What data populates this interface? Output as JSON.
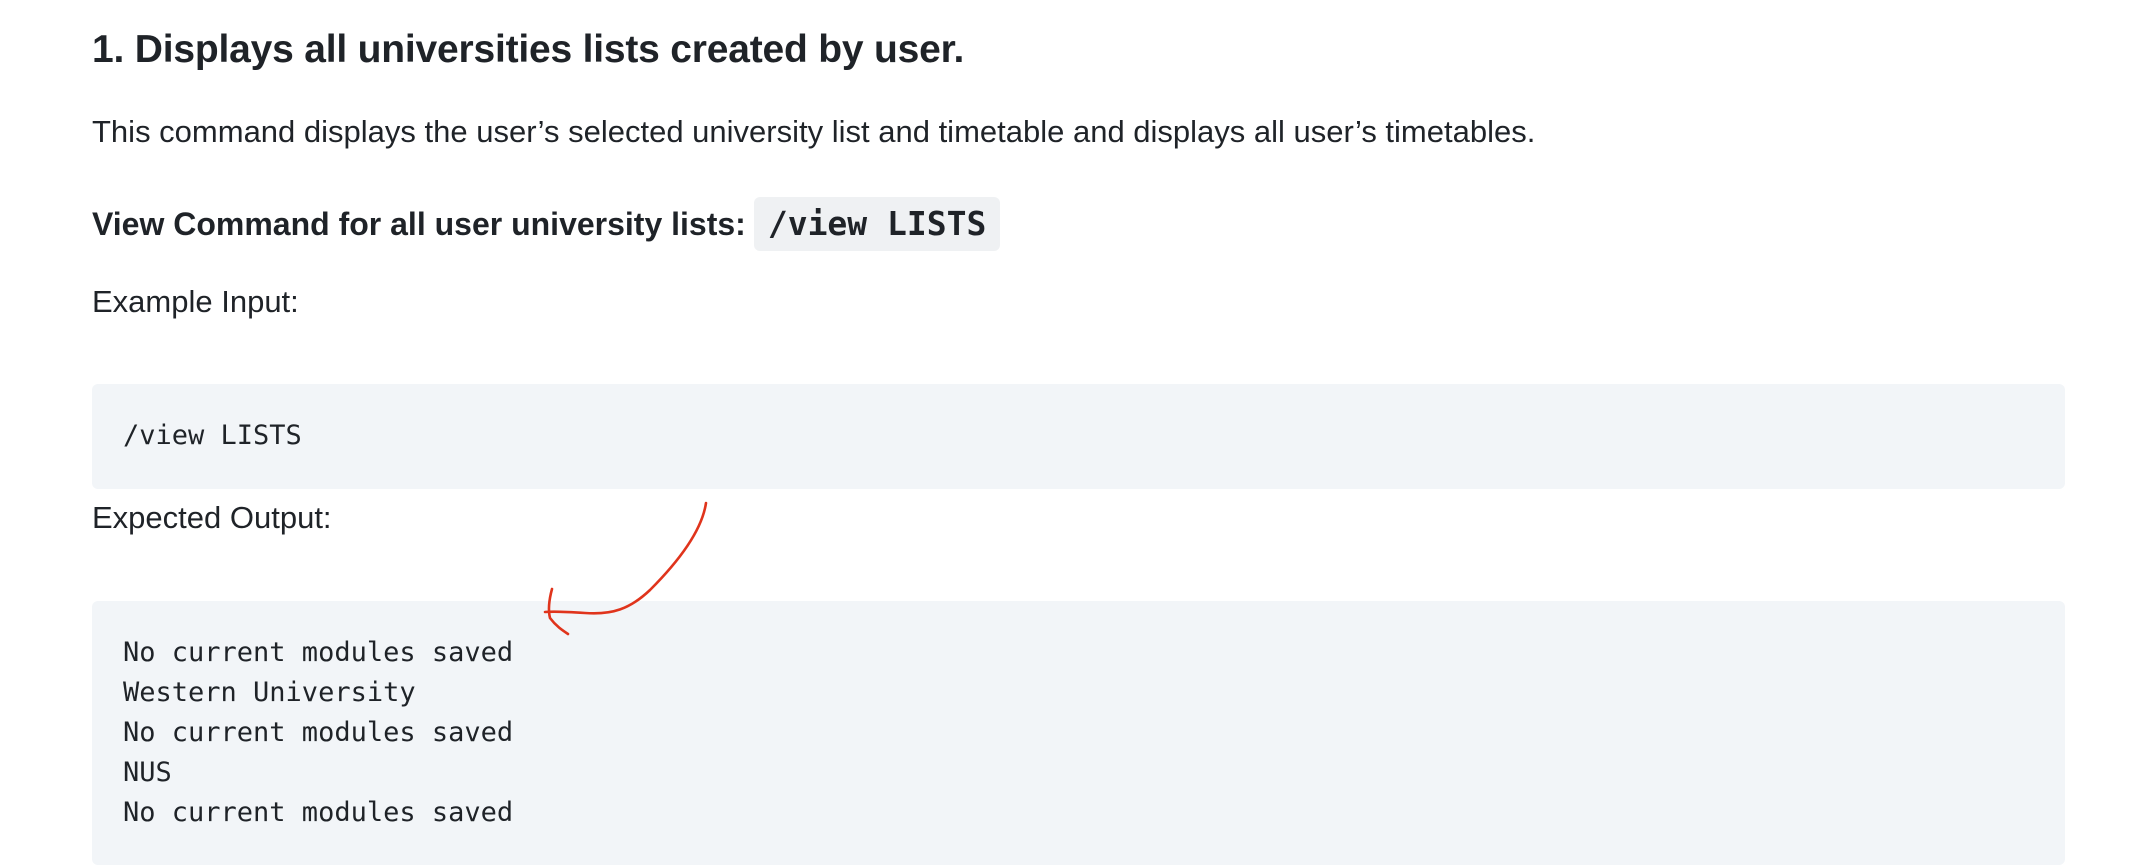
{
  "section": {
    "heading": "1. Displays all universities lists created by user.",
    "description": "This command displays the user’s selected university list and timetable and displays all user’s timetables."
  },
  "command": {
    "label": "View Command for all user university lists:",
    "code": "/view LISTS"
  },
  "example_input": {
    "label": "Example Input:",
    "lines": [
      "/view LISTS"
    ]
  },
  "expected_output": {
    "label": "Expected Output:",
    "lines": [
      "No current modules saved",
      "Western University",
      "No current modules saved",
      "NUS",
      "No current modules saved"
    ]
  },
  "colors": {
    "annotation_stroke": "#e0341c",
    "code_background": "#f2f5f8",
    "inline_code_background": "#eff1f3",
    "text": "#1f2328"
  }
}
